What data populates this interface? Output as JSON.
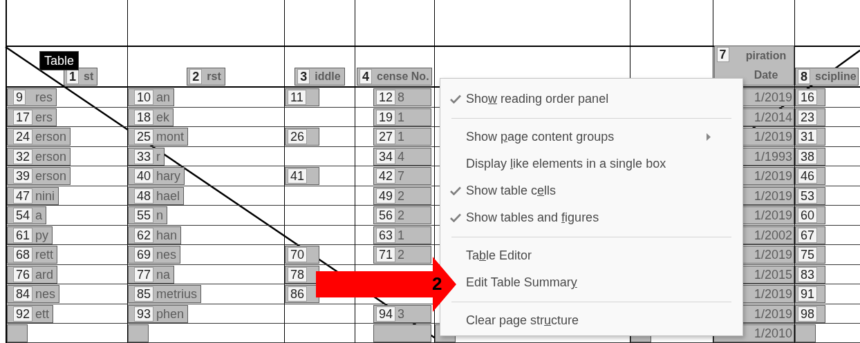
{
  "table_label": "Table",
  "columns": [
    {
      "number": "1",
      "text": "st"
    },
    {
      "number": "2",
      "text": "rst"
    },
    {
      "number": "3",
      "text": "iddle"
    },
    {
      "number": "4",
      "text": "cense No."
    },
    null,
    null,
    {
      "number": "7",
      "text": "piration Date"
    },
    {
      "number": "8",
      "text": "scipline"
    }
  ],
  "rows": [
    {
      "cells": [
        {
          "number": "9",
          "text": "res"
        },
        {
          "number": "10",
          "text": "an"
        },
        {
          "number": "11"
        },
        {
          "number": "12",
          "text": "8"
        },
        null,
        null,
        {
          "text": "1/2019"
        },
        {
          "number": "16"
        }
      ]
    },
    {
      "cells": [
        {
          "number": "17",
          "text": "ers"
        },
        {
          "number": "18",
          "text": "ek"
        },
        null,
        {
          "number": "19",
          "text": "1"
        },
        null,
        null,
        {
          "text": "1/2014"
        },
        {
          "number": "23"
        }
      ]
    },
    {
      "cells": [
        {
          "number": "24",
          "text": "erson"
        },
        {
          "number": "25",
          "text": "mont"
        },
        {
          "number": "26"
        },
        {
          "number": "27",
          "text": "1"
        },
        null,
        null,
        {
          "text": "1/2019"
        },
        {
          "number": "31"
        }
      ]
    },
    {
      "cells": [
        {
          "number": "32",
          "text": "erson"
        },
        {
          "number": "33",
          "text": "r"
        },
        null,
        {
          "number": "34",
          "text": "4"
        },
        null,
        null,
        {
          "text": "1/1993"
        },
        {
          "number": "38"
        }
      ]
    },
    {
      "cells": [
        {
          "number": "39",
          "text": "erson"
        },
        {
          "number": "40",
          "text": "hary"
        },
        {
          "number": "41"
        },
        {
          "number": "42",
          "text": "7"
        },
        null,
        null,
        {
          "text": "1/2019"
        },
        {
          "number": "46"
        }
      ]
    },
    {
      "cells": [
        {
          "number": "47",
          "text": "nini"
        },
        {
          "number": "48",
          "text": "hael"
        },
        null,
        {
          "number": "49",
          "text": "2"
        },
        null,
        null,
        {
          "text": "1/2019"
        },
        {
          "number": "53"
        }
      ]
    },
    {
      "cells": [
        {
          "number": "54",
          "text": "a"
        },
        {
          "number": "55",
          "text": "n"
        },
        null,
        {
          "number": "56",
          "text": "2"
        },
        null,
        null,
        {
          "text": "1/2019"
        },
        {
          "number": "60"
        }
      ]
    },
    {
      "cells": [
        {
          "number": "61",
          "text": "py"
        },
        {
          "number": "62",
          "text": "han"
        },
        null,
        {
          "number": "63",
          "text": "1"
        },
        null,
        null,
        {
          "text": "1/2002"
        },
        {
          "number": "67"
        }
      ]
    },
    {
      "cells": [
        {
          "number": "68",
          "text": "rett"
        },
        {
          "number": "69",
          "text": "nes"
        },
        {
          "number": "70"
        },
        {
          "number": "71",
          "text": "2"
        },
        null,
        null,
        {
          "text": "1/2019"
        },
        {
          "number": "75"
        }
      ]
    },
    {
      "cells": [
        {
          "number": "76",
          "text": "ard"
        },
        {
          "number": "77",
          "text": "na"
        },
        {
          "number": "78"
        },
        null,
        null,
        null,
        {
          "text": "1/2015"
        },
        {
          "number": "83"
        }
      ]
    },
    {
      "cells": [
        {
          "number": "84",
          "text": "nes"
        },
        {
          "number": "85",
          "text": "metrius"
        },
        {
          "number": "86"
        },
        null,
        null,
        null,
        {
          "text": "1/2019"
        },
        {
          "number": "91"
        }
      ]
    },
    {
      "cells": [
        {
          "number": "92",
          "text": "ett"
        },
        {
          "number": "93",
          "text": "phen"
        },
        null,
        {
          "number": "94",
          "text": "3"
        },
        null,
        null,
        {
          "text": "1/2019"
        },
        {
          "number": "98"
        }
      ]
    },
    {
      "cells": [
        {},
        {},
        null,
        {},
        {},
        {},
        {
          "text": "1/2010"
        },
        {}
      ]
    }
  ],
  "menu": [
    {
      "kind": "item",
      "checked": true,
      "submenu": false,
      "label": {
        "before": "Sho",
        "key": "w",
        "after": " reading order panel"
      }
    },
    {
      "kind": "separator"
    },
    {
      "kind": "item",
      "checked": false,
      "submenu": true,
      "label": {
        "before": "Show ",
        "key": "p",
        "after": "age content groups"
      }
    },
    {
      "kind": "item",
      "checked": false,
      "submenu": false,
      "label": {
        "before": "Display ",
        "key": "l",
        "after": "ike elements in a single box"
      }
    },
    {
      "kind": "item",
      "checked": true,
      "submenu": false,
      "label": {
        "before": "Show table c",
        "key": "e",
        "after": "lls"
      }
    },
    {
      "kind": "item",
      "checked": true,
      "submenu": false,
      "label": {
        "before": "Show tables and ",
        "key": "f",
        "after": "igures"
      }
    },
    {
      "kind": "separator"
    },
    {
      "kind": "item",
      "checked": false,
      "submenu": false,
      "label": {
        "before": "Ta",
        "key": "b",
        "after": "le Editor"
      }
    },
    {
      "kind": "item",
      "checked": false,
      "submenu": false,
      "label": {
        "before": "Edit Table Summar",
        "key": "y"
      }
    },
    {
      "kind": "separator"
    },
    {
      "kind": "item",
      "checked": false,
      "submenu": false,
      "label": {
        "before": "Clear page str",
        "key": "u",
        "after": "cture"
      }
    }
  ],
  "callout": {
    "label": "2"
  }
}
